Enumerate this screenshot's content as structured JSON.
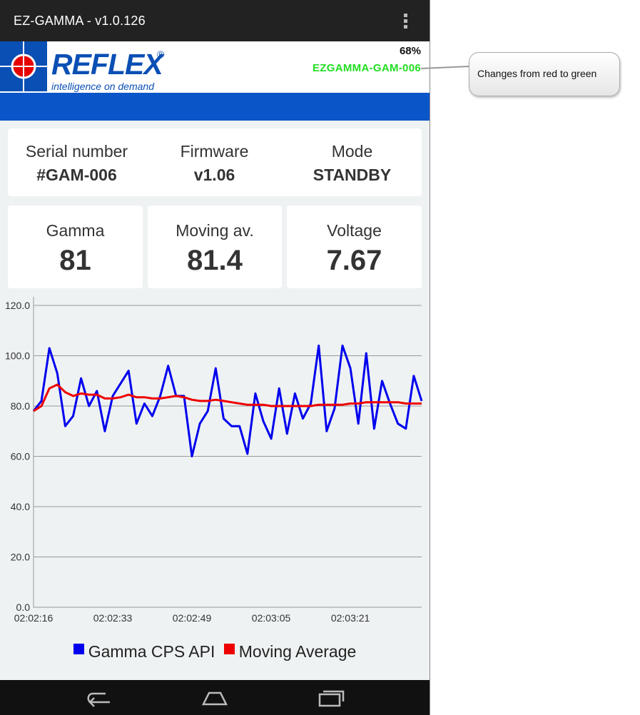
{
  "app": {
    "title": "EZ-GAMMA - v1.0.126"
  },
  "header": {
    "logo_word": "REFLEX",
    "logo_reg": "®",
    "logo_tagline": "intelligence on demand",
    "battery": "68%",
    "device_name": "EZGAMMA-GAM-006",
    "device_name_color": "#22dd22"
  },
  "info": [
    {
      "label": "Serial number",
      "value": "#GAM-006"
    },
    {
      "label": "Firmware",
      "value": "v1.06"
    },
    {
      "label": "Mode",
      "value": "STANDBY"
    }
  ],
  "metrics": [
    {
      "label": "Gamma",
      "value": "81"
    },
    {
      "label": "Moving av.",
      "value": "81.4"
    },
    {
      "label": "Voltage",
      "value": "7.67"
    }
  ],
  "chart_data": {
    "type": "line",
    "ylim": [
      0,
      120
    ],
    "yticks": [
      0,
      20,
      40,
      60,
      80,
      100,
      120
    ],
    "ytick_labels": [
      "0.0",
      "20.0",
      "40.0",
      "60.0",
      "80.0",
      "100.0",
      "120.0"
    ],
    "x_tick_labels": [
      "02:02:16",
      "02:02:33",
      "02:02:49",
      "02:03:05",
      "02:03:21"
    ],
    "x_tick_indices": [
      0,
      10,
      20,
      30,
      40
    ],
    "n_points": 50,
    "grid": true,
    "legend": "bottom",
    "series": [
      {
        "name": "Gamma CPS API",
        "color": "#0000ee",
        "values": [
          78,
          82,
          103,
          93,
          72,
          76,
          91,
          80,
          86,
          70,
          84,
          89,
          94,
          73,
          81,
          76,
          84,
          96,
          84,
          84,
          60,
          73,
          78,
          95,
          75,
          72,
          72,
          61,
          85,
          74,
          67,
          87,
          69,
          85,
          75,
          81,
          104,
          70,
          79,
          104,
          95,
          73,
          101,
          71,
          90,
          81,
          73,
          71,
          92,
          82
        ]
      },
      {
        "name": "Moving Average",
        "color": "#ee0000",
        "values": [
          78,
          80,
          87,
          88.5,
          85.5,
          84,
          85,
          84.5,
          84.5,
          83,
          83,
          83.5,
          84.5,
          83.5,
          83.5,
          83,
          83,
          83.5,
          84,
          83.5,
          82.5,
          82,
          82,
          82.5,
          82,
          81.5,
          81,
          80.5,
          80.5,
          80.5,
          80,
          80,
          80,
          80,
          80,
          80,
          80.5,
          80.5,
          80.5,
          80.5,
          81,
          81,
          81.5,
          81.5,
          81.5,
          81.5,
          81.5,
          81,
          81,
          81
        ]
      }
    ]
  },
  "callout": {
    "text": "Changes from red to green"
  }
}
